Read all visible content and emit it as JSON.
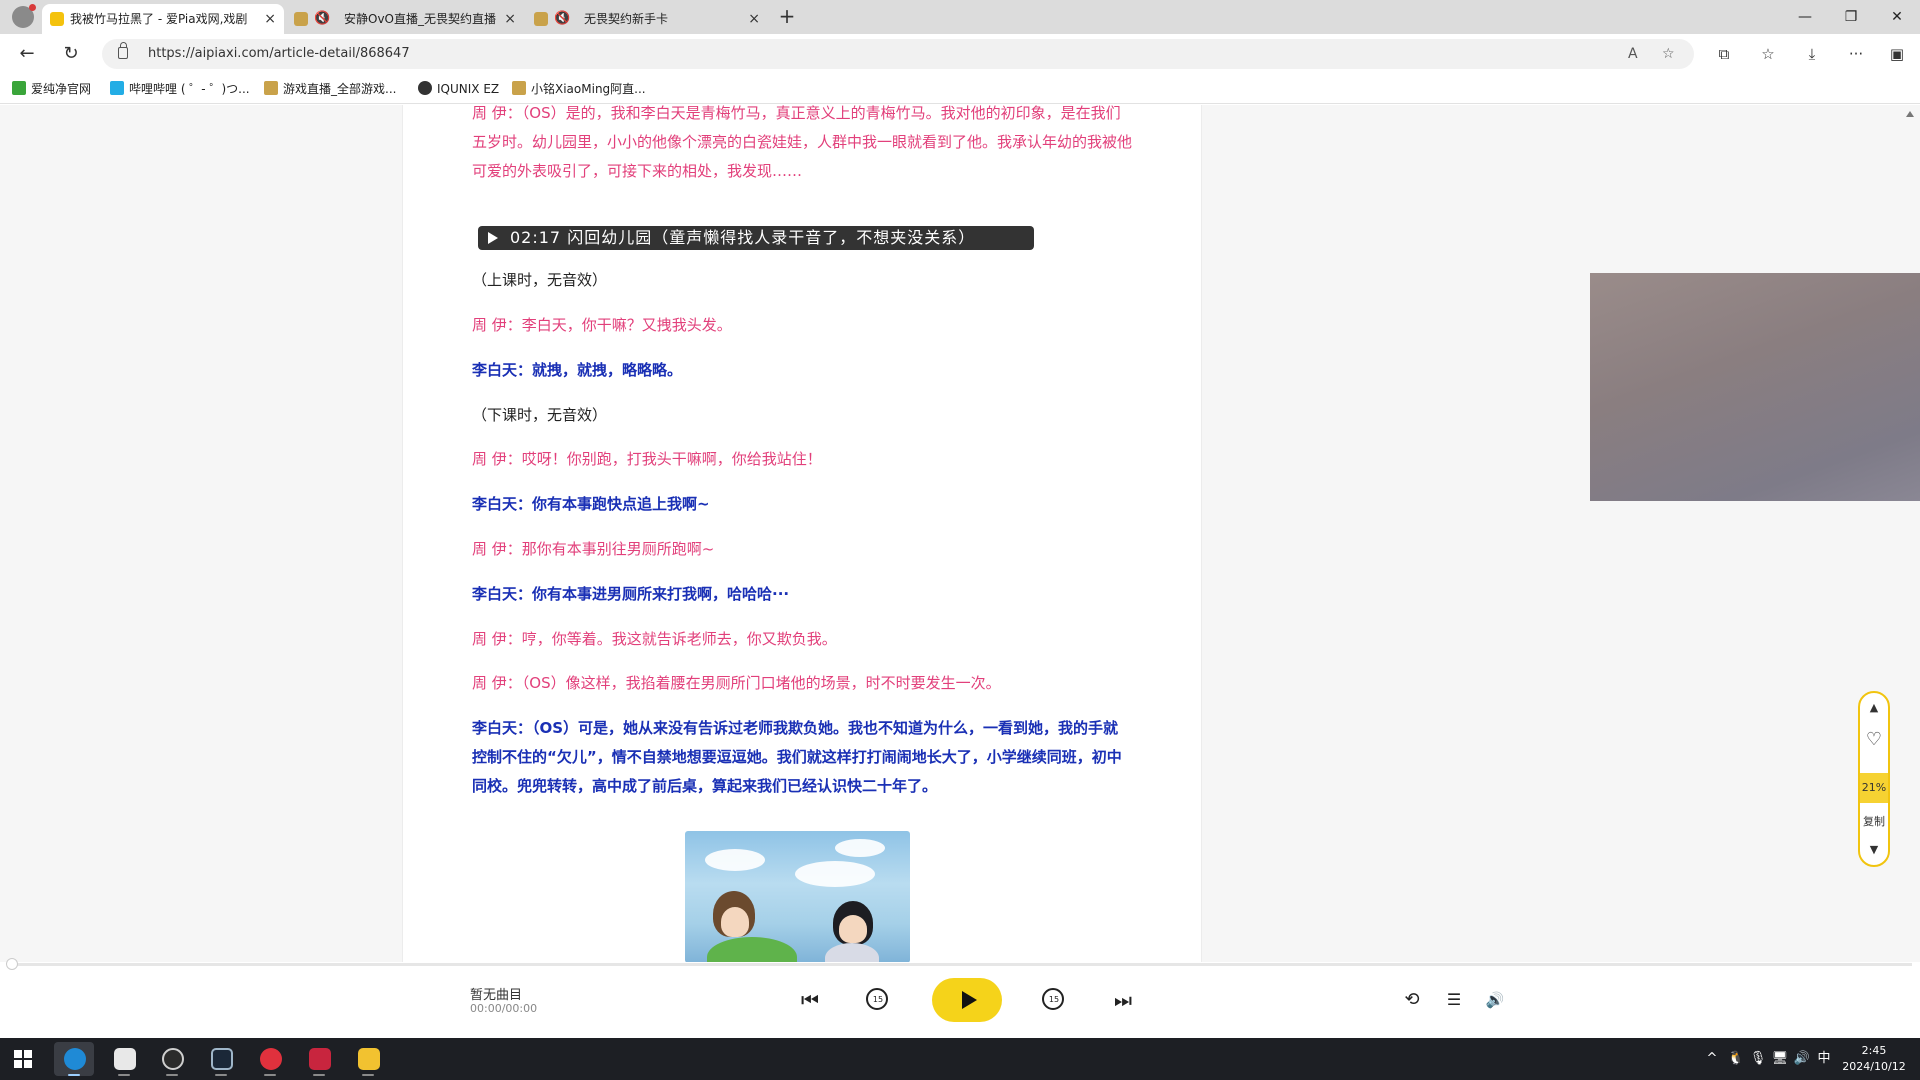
{
  "browser": {
    "tabs": [
      {
        "title": "我被竹马拉黑了 - 爱Pia戏网,戏剧",
        "active": true,
        "muted": false
      },
      {
        "title": "安静OvO直播_无畏契约直播",
        "active": false,
        "muted": true
      },
      {
        "title": "无畏契约新手卡",
        "active": false,
        "muted": true
      }
    ],
    "tab_close_glyph": "×",
    "new_tab_glyph": "+",
    "window_controls": {
      "minimize": "—",
      "restore": "❐",
      "close": "✕"
    },
    "nav": {
      "back": "←",
      "refresh": "↻"
    },
    "url": "https://aipiaxi.com/article-detail/868647",
    "url_icons": {
      "read_aloud": "A",
      "favorite": "☆"
    },
    "toolbar_icons": {
      "split": "⧉",
      "favorites": "☆",
      "downloads": "⤓",
      "more": "···",
      "sidebar": "▣"
    },
    "bookmarks": [
      {
        "label": "爱纯净官网",
        "color": "#3aa53a"
      },
      {
        "label": "哔哩哔哩 ( ゜- ゜)つ...",
        "color": "#23ade5"
      },
      {
        "label": "游戏直播_全部游戏...",
        "color": "#c9a24a"
      },
      {
        "label": "IQUNIX EZ",
        "color": "#333333"
      },
      {
        "label": "小铭XiaoMing阿直...",
        "color": "#c9a24a"
      }
    ]
  },
  "article": {
    "lines": [
      {
        "role": "zhou",
        "text": "周 伊：（OS）是的，我和李白天是青梅竹马，真正意义上的青梅竹马。我对他的初印象，是在我们五岁时。幼儿园里，小小的他像个漂亮的白瓷娃娃，人群中我一眼就看到了他。我承认年幼的我被他可爱的外表吸引了，可接下来的相处，我发现……"
      },
      {
        "role": "stage",
        "text": "（上课时，无音效）"
      },
      {
        "role": "zhou",
        "text": "周 伊：李白天，你干嘛？又拽我头发。"
      },
      {
        "role": "li",
        "text": "李白天：就拽，就拽，略略略。"
      },
      {
        "role": "stage",
        "text": "（下课时，无音效）"
      },
      {
        "role": "zhou",
        "text": "周 伊：哎呀！你别跑，打我头干嘛啊，你给我站住！"
      },
      {
        "role": "li",
        "text": "李白天：你有本事跑快点追上我啊~"
      },
      {
        "role": "zhou",
        "text": "周 伊：那你有本事别往男厕所跑啊~"
      },
      {
        "role": "li",
        "text": "李白天：你有本事进男厕所来打我啊，哈哈哈···"
      },
      {
        "role": "zhou",
        "text": "周 伊：哼，你等着。我这就告诉老师去，你又欺负我。"
      },
      {
        "role": "zhou",
        "text": "周 伊：（OS）像这样，我掐着腰在男厕所门口堵他的场景，时不时要发生一次。"
      },
      {
        "role": "li",
        "text": "李白天：（OS）可是，她从来没有告诉过老师我欺负她。我也不知道为什么，一看到她，我的手就控制不住的“欠儿”，情不自禁地想要逗逗她。我们就这样打打闹闹地长大了，小学继续同班，初中同校。兜兜转转，高中成了前后桌，算起来我们已经认识快二十年了。"
      }
    ],
    "audio_cue": "02:17 闪回幼儿园（童声懒得找人录干音了，不想夹没关系）"
  },
  "floating_widget": {
    "up": "▲",
    "like": "♡",
    "progress_percent": "21%",
    "copy": "复制",
    "down": "▼"
  },
  "player": {
    "title": "暂无曲目",
    "time": "00:00/00:00",
    "progress": 0,
    "skip_seconds": "15",
    "icons": {
      "prev": "⏮",
      "next": "⏭",
      "repeat": "⟲",
      "playlist": "☰",
      "volume": "🔊"
    }
  },
  "taskbar": {
    "apps": [
      {
        "name": "edge",
        "color": "#1f8ad6",
        "active": true
      },
      {
        "name": "app-2",
        "color": "#e8e8e8",
        "active": false
      },
      {
        "name": "obs",
        "color": "#2b2b2b",
        "active": false
      },
      {
        "name": "steam",
        "color": "#1b2838",
        "active": false
      },
      {
        "name": "netease-music",
        "color": "#e0313d",
        "active": false
      },
      {
        "name": "valorant",
        "color": "#c8253e",
        "active": false
      },
      {
        "name": "game-7",
        "color": "#f2c230",
        "active": false
      }
    ],
    "tray": {
      "overflow": "^",
      "ime": "中"
    },
    "time": "2:45",
    "date": "2024/10/12"
  }
}
